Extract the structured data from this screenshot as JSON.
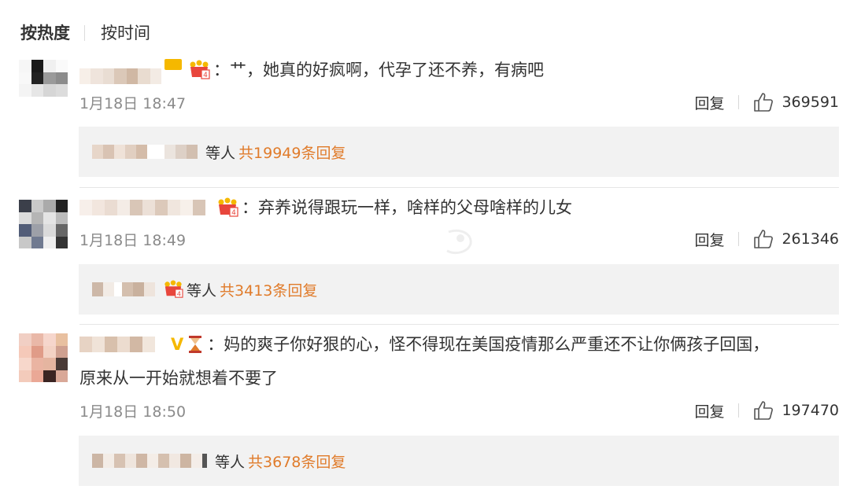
{
  "sort_tabs": {
    "hot_label": "按热度",
    "time_label": "按时间"
  },
  "comments": [
    {
      "text": "：艹，她真的好疯啊，代孕了还不养，有病吧",
      "time": "1月18日 18:47",
      "reply_label": "回复",
      "likes": "369591",
      "sub_suffix": "等人",
      "sub_count_text": "共19949条回复"
    },
    {
      "text": "：弃养说得跟玩一样，啥样的父母啥样的儿女",
      "time": "1月18日 18:49",
      "reply_label": "回复",
      "likes": "261346",
      "sub_suffix": "等人",
      "sub_count_text": "共3413条回复"
    },
    {
      "text_line1": "：妈的爽子你好狠的心，怪不得现在美国疫情那么严重还不让你俩孩子回国，",
      "text_line2": "原来从一开始就想着不要了",
      "time": "1月18日 18:50",
      "reply_label": "回复",
      "likes": "197470",
      "sub_suffix": "等人",
      "sub_count_text": "共3678条回复",
      "v_badge": "V"
    }
  ],
  "colors": {
    "accent_orange": "#e07b2a",
    "sub_box_bg": "#f2f2f2",
    "time_gray": "#8a8a8a",
    "crown_gold": "#f5b800",
    "crown_red": "#e8463c"
  }
}
